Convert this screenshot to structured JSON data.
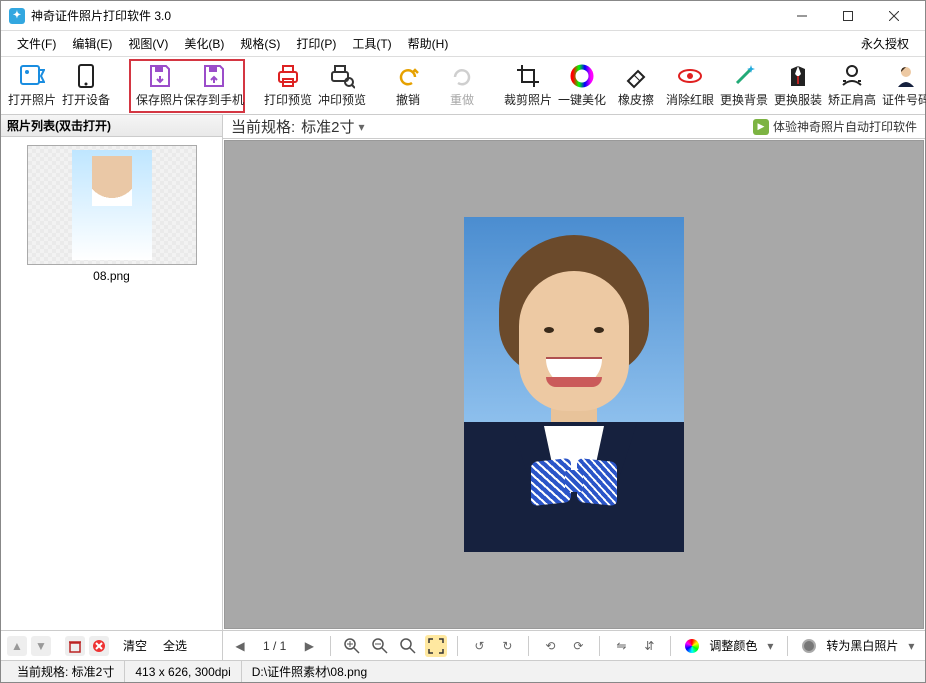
{
  "window": {
    "title": "神奇证件照片打印软件 3.0"
  },
  "menubar": {
    "file": "文件(F)",
    "edit": "编辑(E)",
    "view": "视图(V)",
    "beauty": "美化(B)",
    "spec": "规格(S)",
    "print": "打印(P)",
    "tools": "工具(T)",
    "help": "帮助(H)",
    "license": "永久授权"
  },
  "toolbar": {
    "open_photo": "打开照片",
    "open_device": "打开设备",
    "save_photo": "保存照片",
    "save_to_phone": "保存到手机",
    "print_preview": "打印预览",
    "dev_preview": "冲印预览",
    "undo": "撤销",
    "redo": "重做",
    "crop": "裁剪照片",
    "one_key": "一键美化",
    "eraser": "橡皮擦",
    "redeye": "消除红眼",
    "change_bg": "更换背景",
    "change_cloth": "更换服装",
    "fix_shoulder": "矫正肩高",
    "id_number": "证件号码"
  },
  "sidebar": {
    "header": "照片列表(双击打开)",
    "thumb_name": "08.png",
    "clear": "清空",
    "select_all": "全选"
  },
  "info": {
    "spec_label": "当前规格:",
    "spec_value": "标准2寸",
    "promo": "体验神奇照片自动打印软件"
  },
  "mainfooter": {
    "page": "1 / 1",
    "adjust_color": "调整颜色",
    "to_bw": "转为黑白照片"
  },
  "statusbar": {
    "spec": "当前规格: 标准2寸",
    "dim": "413 x 626, 300dpi",
    "path": "D:\\证件照素材\\08.png"
  }
}
